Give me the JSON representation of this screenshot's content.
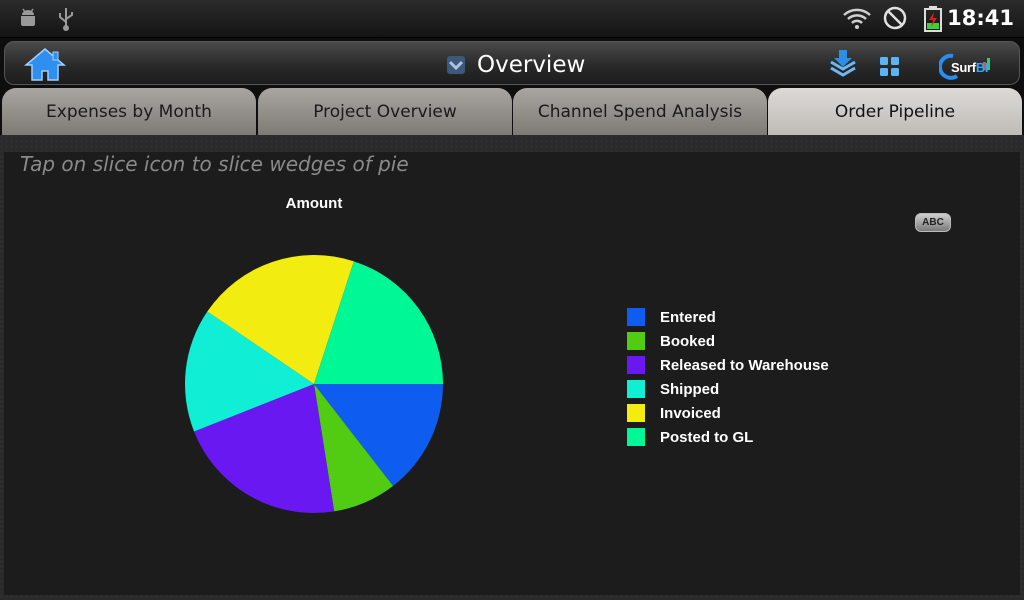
{
  "status_bar": {
    "time": "18:41",
    "left_icons": [
      "android-debug-icon",
      "usb-icon"
    ],
    "right_icons": [
      "wifi-icon",
      "do-not-disturb-icon",
      "battery-charging-icon"
    ]
  },
  "action_bar": {
    "title": "Overview",
    "brand_prefix": "Surf",
    "brand_suffix": "BI",
    "accent": "#2a8df0"
  },
  "tabs": [
    {
      "label": "Expenses by Month",
      "active": false
    },
    {
      "label": "Project Overview",
      "active": false
    },
    {
      "label": "Channel Spend Analysis",
      "active": false
    },
    {
      "label": "Order Pipeline",
      "active": true
    }
  ],
  "content": {
    "hint": "Tap on slice icon to slice wedges of pie",
    "label_toggle": "ABC"
  },
  "chart_data": {
    "type": "pie",
    "title": "Amount",
    "legend_position": "right",
    "categories": [
      "Entered",
      "Booked",
      "Released to Warehouse",
      "Shipped",
      "Invoiced",
      "Posted to GL"
    ],
    "values": [
      14.5,
      8.0,
      21.5,
      15.5,
      20.5,
      20.0
    ],
    "colors": [
      "#0f5cf0",
      "#52cc12",
      "#6a18f2",
      "#10efd6",
      "#f2ec10",
      "#00f796"
    ]
  }
}
